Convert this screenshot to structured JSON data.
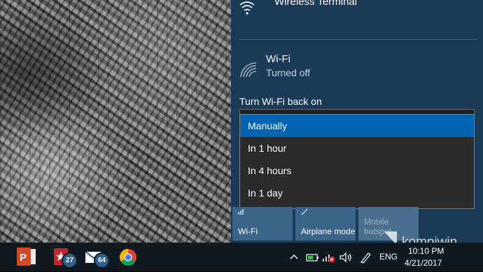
{
  "network_panel": {
    "wireless_terminal": {
      "label": "Wireless Terminal",
      "icon": "wifi-signal-icon"
    },
    "wifi": {
      "title": "Wi-Fi",
      "status": "Turned off",
      "icon": "wifi-off-icon"
    },
    "turn_back_label": "Turn Wi-Fi back on",
    "dropdown": {
      "options": [
        "Manually",
        "In 1 hour",
        "In 4 hours",
        "In 1 day"
      ],
      "selected": "Manually"
    },
    "quick_actions": [
      {
        "label": "Wi-Fi",
        "icon": "wifi-icon"
      },
      {
        "label": "Airplane mode",
        "icon": "airplane-icon"
      },
      {
        "label": "Mobile hotspot",
        "icon": "hotspot-icon",
        "disabled": true
      }
    ]
  },
  "taskbar": {
    "apps": [
      {
        "name": "PowerPoint",
        "icon": "powerpoint-icon",
        "color": "#d24726"
      },
      {
        "name": "Task app",
        "icon": "calendar-star-icon",
        "color": "#c1272d",
        "badge": "27"
      },
      {
        "name": "Mail",
        "icon": "mail-icon",
        "badge": "64"
      },
      {
        "name": "Chrome",
        "icon": "chrome-icon"
      }
    ],
    "tray": {
      "icons": [
        "chevron-up-icon",
        "battery-icon",
        "network-disabled-icon",
        "volume-icon",
        "pen-icon"
      ],
      "language": "ENG",
      "time": "10:10 PM",
      "date": "4/21/2017"
    }
  },
  "watermark": {
    "text": "kompiwin"
  },
  "colors": {
    "panel_bg": "#1b3a58",
    "accent": "#0063b1",
    "tile_active": "#3a6388",
    "taskbar_bg": "#101820"
  }
}
